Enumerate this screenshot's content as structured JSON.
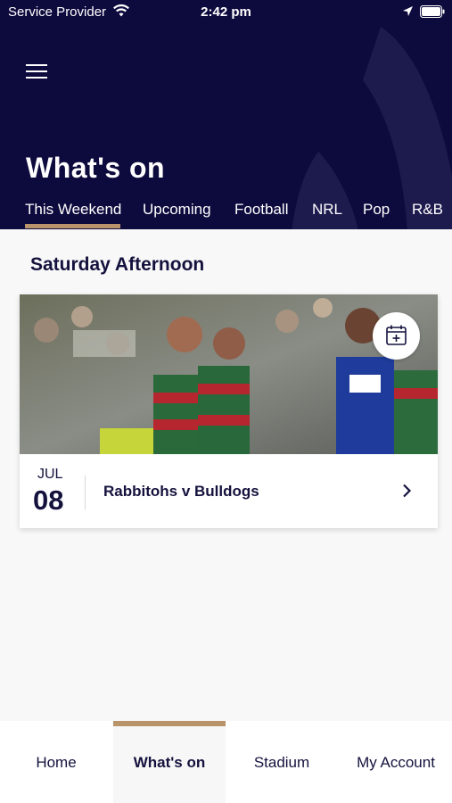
{
  "status_bar": {
    "carrier": "Service Provider",
    "time": "2:42 pm"
  },
  "header": {
    "title": "What's on",
    "menu_icon": "hamburger-menu-icon",
    "background_color": "#0d0a3d",
    "accent_color": "#b9936a"
  },
  "tabs": [
    {
      "label": "This Weekend",
      "active": true
    },
    {
      "label": "Upcoming",
      "active": false
    },
    {
      "label": "Football",
      "active": false
    },
    {
      "label": "NRL",
      "active": false
    },
    {
      "label": "Pop",
      "active": false
    },
    {
      "label": "R&B",
      "active": false
    }
  ],
  "main": {
    "section_title": "Saturday Afternoon",
    "events": [
      {
        "month": "JUL",
        "day": "08",
        "title": "Rabbitohs v Bulldogs",
        "calendar_icon": "calendar-add-icon",
        "chevron_icon": "chevron-right-icon"
      }
    ]
  },
  "bottom_nav": [
    {
      "label": "Home",
      "active": false
    },
    {
      "label": "What's on",
      "active": true
    },
    {
      "label": "Stadium",
      "active": false
    },
    {
      "label": "My Account",
      "active": false
    }
  ]
}
